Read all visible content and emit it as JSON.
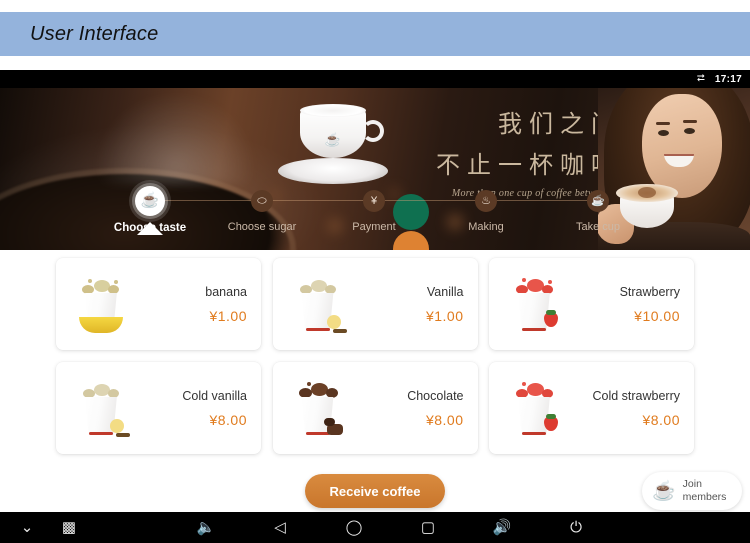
{
  "page": {
    "title": "User Interface",
    "header_color": "#94b3dc"
  },
  "statusbar": {
    "bluetooth_icon": "bluetooth-icon",
    "time": "17:17"
  },
  "banner": {
    "slogan_cn_line1": "我们之间",
    "slogan_cn_line2": "不止一杯咖啡",
    "slogan_en": "More than one cup of coffee between us",
    "dots": [
      {
        "name": "indicator-dot-green",
        "color": "#0f7050"
      },
      {
        "name": "indicator-dot-orange",
        "color": "#de8232"
      }
    ],
    "cup_logo_glyph": "☕"
  },
  "steps": [
    {
      "label": "Choose taste",
      "icon": "coffee-cup-icon",
      "glyph": "☕",
      "active": true
    },
    {
      "label": "Choose sugar",
      "icon": "sugar-cube-icon",
      "glyph": "⬭",
      "active": false
    },
    {
      "label": "Payment",
      "icon": "yuan-currency-icon",
      "glyph": "¥",
      "active": false
    },
    {
      "label": "Making",
      "icon": "brewing-cup-icon",
      "glyph": "♨",
      "active": false
    },
    {
      "label": "Take cup",
      "icon": "take-cup-icon",
      "glyph": "☕",
      "active": false
    }
  ],
  "menu": {
    "currency": "¥",
    "items": [
      {
        "name": "banana",
        "price": "¥1.00",
        "thumb": "banana-drink-thumb",
        "accent": "#d9b84a",
        "splash": "#cfc089"
      },
      {
        "name": "Vanilla",
        "price": "¥1.00",
        "thumb": "vanilla-drink-thumb",
        "accent": "#f0d878",
        "splash": "#d8cda0"
      },
      {
        "name": "Strawberry",
        "price": "¥10.00",
        "thumb": "strawberry-drink-thumb",
        "accent": "#e03b32",
        "splash": "#e0473c"
      },
      {
        "name": "Cold vanilla",
        "price": "¥8.00",
        "thumb": "cold-vanilla-drink-thumb",
        "accent": "#f0d878",
        "splash": "#d8cda0"
      },
      {
        "name": "Chocolate",
        "price": "¥8.00",
        "thumb": "chocolate-drink-thumb",
        "accent": "#5b3venue",
        "splash": "#5a3520"
      },
      {
        "name": "Cold strawberry",
        "price": "¥8.00",
        "thumb": "cold-strawberry-drink-thumb",
        "accent": "#e03b32",
        "splash": "#e0473c"
      }
    ]
  },
  "actions": {
    "receive_label": "Receive coffee",
    "join_icon": "steaming-coffee-cup-icon",
    "join_glyph": "☕",
    "join_line1": "Join",
    "join_line2": "members"
  },
  "navbar": [
    {
      "name": "collapse-icon",
      "glyph": "⌄"
    },
    {
      "name": "screenshot-icon",
      "glyph": "▣"
    },
    {
      "name": "volume-down-icon",
      "glyph": "🔈"
    },
    {
      "name": "back-icon",
      "glyph": "◁"
    },
    {
      "name": "home-icon",
      "glyph": "◯"
    },
    {
      "name": "recents-icon",
      "glyph": "▢"
    },
    {
      "name": "volume-up-icon",
      "glyph": "🔊"
    },
    {
      "name": "power-icon",
      "glyph": "⏻"
    }
  ]
}
